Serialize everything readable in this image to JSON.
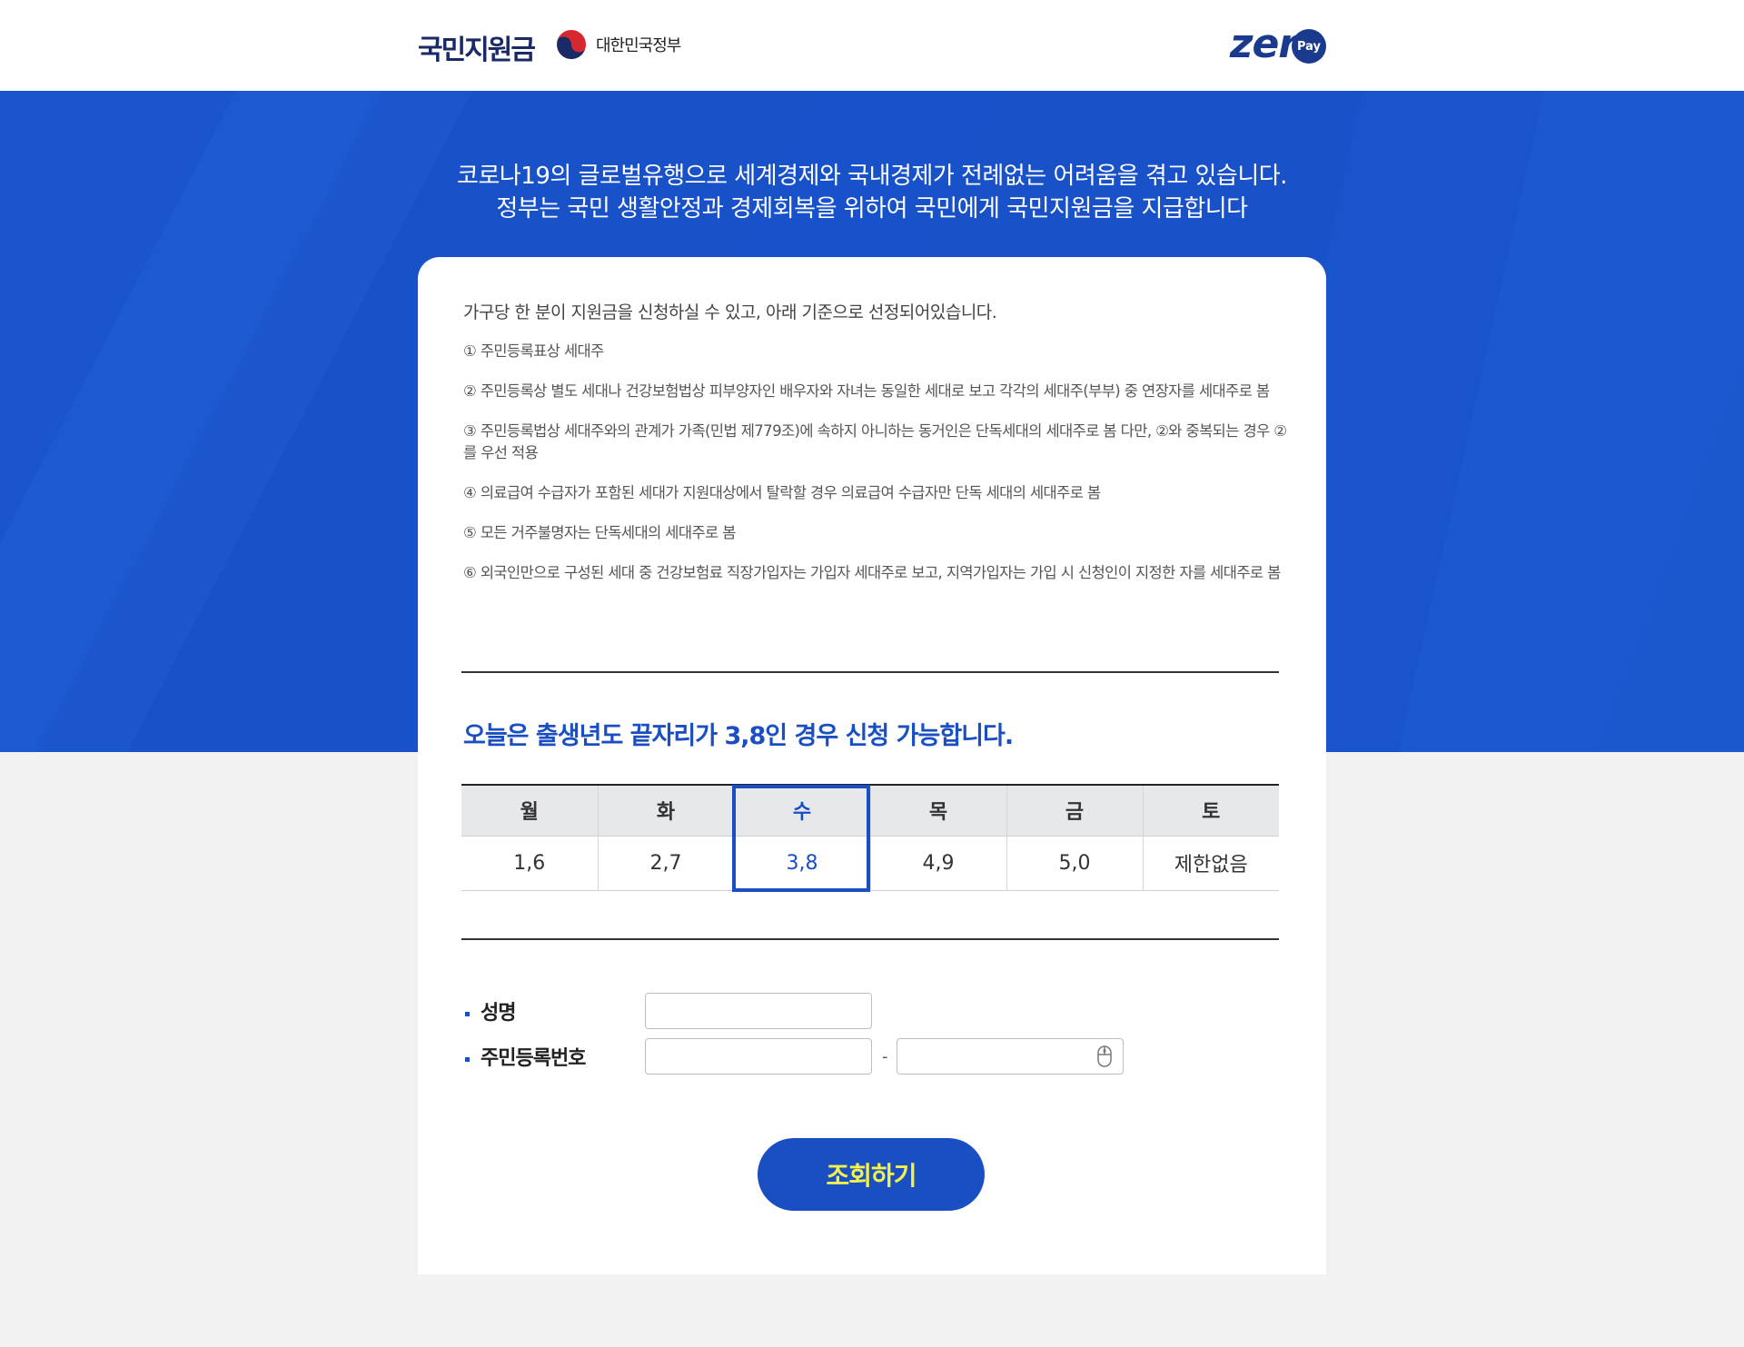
{
  "header": {
    "logo_text": "국민지원금",
    "gov_text": "대한민국정부",
    "zeropay_text": "zer",
    "pay_text": "Pay"
  },
  "hero": {
    "line1": "코로나19의 글로벌유행으로 세계경제와 국내경제가 전례없는 어려움을 겪고 있습니다.",
    "line2": "정부는 국민 생활안정과 경제회복을 위하여 국민에게 국민지원금을 지급합니다"
  },
  "card": {
    "intro": "가구당 한 분이 지원금을 신청하실 수 있고, 아래 기준으로 선정되어있습니다.",
    "criteria": [
      "① 주민등록표상 세대주",
      "② 주민등록상 별도 세대나 건강보험법상 피부양자인 배우자와 자녀는 동일한 세대로 보고 각각의 세대주(부부) 중 연장자를 세대주로 봄",
      "③ 주민등록법상 세대주와의 관계가 가족(민법 제779조)에 속하지 아니하는 동거인은 단독세대의 세대주로 봄 다만, ②와 중복되는 경우 ②를 우선 적용",
      "④ 의료급여 수급자가 포함된 세대가 지원대상에서 탈락할 경우 의료급여 수급자만 단독 세대의 세대주로 봄",
      "⑤ 모든 거주불명자는 단독세대의 세대주로 봄",
      "⑥ 외국인만으로 구성된 세대 중 건강보험료 직장가입자는 가입자 세대주로 보고, 지역가입자는 가입 시 신청인이 지정한 자를 세대주로 봄"
    ],
    "today_notice": "오늘은 출생년도 끝자리가 3,8인 경우 신청 가능합니다."
  },
  "schedule": {
    "days": [
      "월",
      "화",
      "수",
      "목",
      "금",
      "토"
    ],
    "digits": [
      "1,6",
      "2,7",
      "3,8",
      "4,9",
      "5,0",
      "제한없음"
    ],
    "today_index": 2,
    "highlight_color": "#1a4fc4"
  },
  "form": {
    "name_label": "성명",
    "rrn_label": "주민등록번호",
    "dash": "-",
    "name_value": "",
    "rrn_front_value": "",
    "rrn_back_value": ""
  },
  "button": {
    "search_label": "조회하기"
  },
  "colors": {
    "hero_bg": "#1851c8",
    "accent": "#1a4fc4",
    "button_text": "#f2f24a"
  }
}
